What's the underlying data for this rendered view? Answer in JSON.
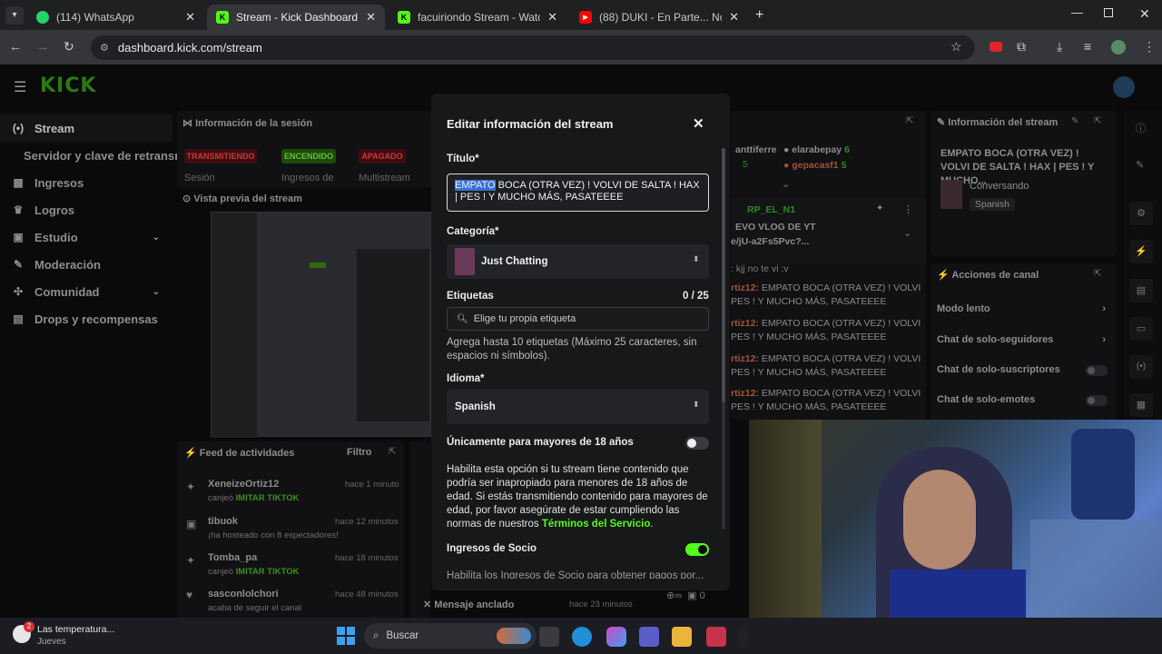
{
  "browser": {
    "tabs": [
      {
        "title": "(114) WhatsApp",
        "fav_color": "#25d366"
      },
      {
        "title": "Stream - Kick Dashboard",
        "fav_color": "#53fc18"
      },
      {
        "title": "facuiriondo Stream - Watch Live",
        "fav_color": "#53fc18"
      },
      {
        "title": "(88) DUKI - En Parte... No lo sé (",
        "fav_color": "#ff0000"
      }
    ],
    "url": "dashboard.kick.com/stream"
  },
  "sidebar": {
    "items": [
      {
        "label": "Stream",
        "icon": "broadcast-icon"
      },
      {
        "label": "Servidor y clave de retransm",
        "icon": ""
      },
      {
        "label": "Ingresos",
        "icon": "revenue-icon"
      },
      {
        "label": "Logros",
        "icon": "trophy-icon"
      },
      {
        "label": "Estudio",
        "icon": "studio-icon"
      },
      {
        "label": "Moderación",
        "icon": "wrench-icon"
      },
      {
        "label": "Comunidad",
        "icon": "community-icon"
      },
      {
        "label": "Drops y recompensas",
        "icon": "drops-icon"
      }
    ]
  },
  "session": {
    "title": "Información de la sesión",
    "badges": [
      "TRANSMITIENDO",
      "ENCENDIDO",
      "APAGADO"
    ],
    "cols": [
      "Sesión",
      "Ingresos de",
      "Multistream"
    ],
    "preview_title": "Vista previa del stream"
  },
  "feed": {
    "title": "Feed de actividades",
    "filter": "Filtro",
    "items": [
      {
        "name": "XeneizeOrtiz12",
        "sub": "canjeó",
        "highlight": "IMITAR TIKTOK",
        "time": "hace 1 minuto"
      },
      {
        "name": "tibuok",
        "sub": "¡ha hosteado con 8 espectadores!",
        "highlight": "",
        "time": "hace 12 minutos"
      },
      {
        "name": "Tomba_pa",
        "sub": "canjeó",
        "highlight": "IMITAR TIKTOK",
        "time": "hace 18 minutos"
      },
      {
        "name": "sasconlolchori",
        "sub": "acaba de seguir el canal",
        "highlight": "",
        "time": "hace 48 minutos"
      }
    ],
    "pinned": "Mensaje anclado",
    "pinned_time": "hace 23 minutos",
    "viewers": "0"
  },
  "chat": {
    "users": [
      "anttiferre",
      "elarabepay",
      "gepacasf1"
    ],
    "counts": [
      "6",
      "5"
    ],
    "pinned_user": "RP_EL_N1",
    "pinned_msg_1": "EVO VLOG DE YT",
    "pinned_msg_2": "e/jU-a2Fs5Pvc?...",
    "reply": ": kjj no te vi :v",
    "msg_user": "rtiz12:",
    "msg": "EMPATO BOCA (OTRA VEZ) ! VOLVI",
    "msg2": "PES ! Y MUCHO MÁS, PASATEEEE"
  },
  "info": {
    "title": "Información del stream",
    "stream_title": "EMPATO BOCA (OTRA VEZ) ! VOLVI DE SALTA ! HAX | PES ! Y MUCHO...",
    "category": "Conversando",
    "language": "Spanish"
  },
  "actions": {
    "title": "Acciones de canal",
    "items": [
      "Modo lento",
      "Chat de solo-seguidores",
      "Chat de solo-suscriptores",
      "Chat de solo-emotes"
    ]
  },
  "modal": {
    "title": "Editar información del stream",
    "title_label": "Título*",
    "title_selected": "EMPATO",
    "title_rest": " BOCA (OTRA VEZ) ! VOLVI DE SALTA ! HAX | PES ! Y MUCHO MÁS, PASATEEEE",
    "category_label": "Categoría*",
    "category_value": "Just Chatting",
    "tags_label": "Etiquetas",
    "tags_count": "0 / 25",
    "tags_placeholder": "Elige tu propia etiqueta",
    "tags_help": "Agrega hasta 10 etiquetas (Máximo 25 caracteres, sin espacios ni símbolos).",
    "lang_label": "Idioma*",
    "lang_value": "Spanish",
    "mature_label": "Únicamente para mayores de 18 años",
    "mature_on": false,
    "mature_help": "Habilita esta opción si tu stream tiene contenido que podría ser inapropiado para menores de 18 años de edad. Si estás transmitiendo contenido para mayores de edad, por favor asegúrate de estar cumpliendo las normas de nuestros",
    "terms_link": "Términos del Servicio",
    "terms_end": ".",
    "partner_label": "Ingresos de Socio",
    "partner_on": true,
    "partner_help": "Habilita los Ingresos de Socio para obtener pagos por..."
  },
  "taskbar": {
    "weather": "Las temperatura...",
    "weather_sub": "Jueves",
    "search": "Buscar",
    "notif": "2"
  },
  "colors": {
    "kick_green": "#53fc18",
    "red": "#e0262a"
  }
}
